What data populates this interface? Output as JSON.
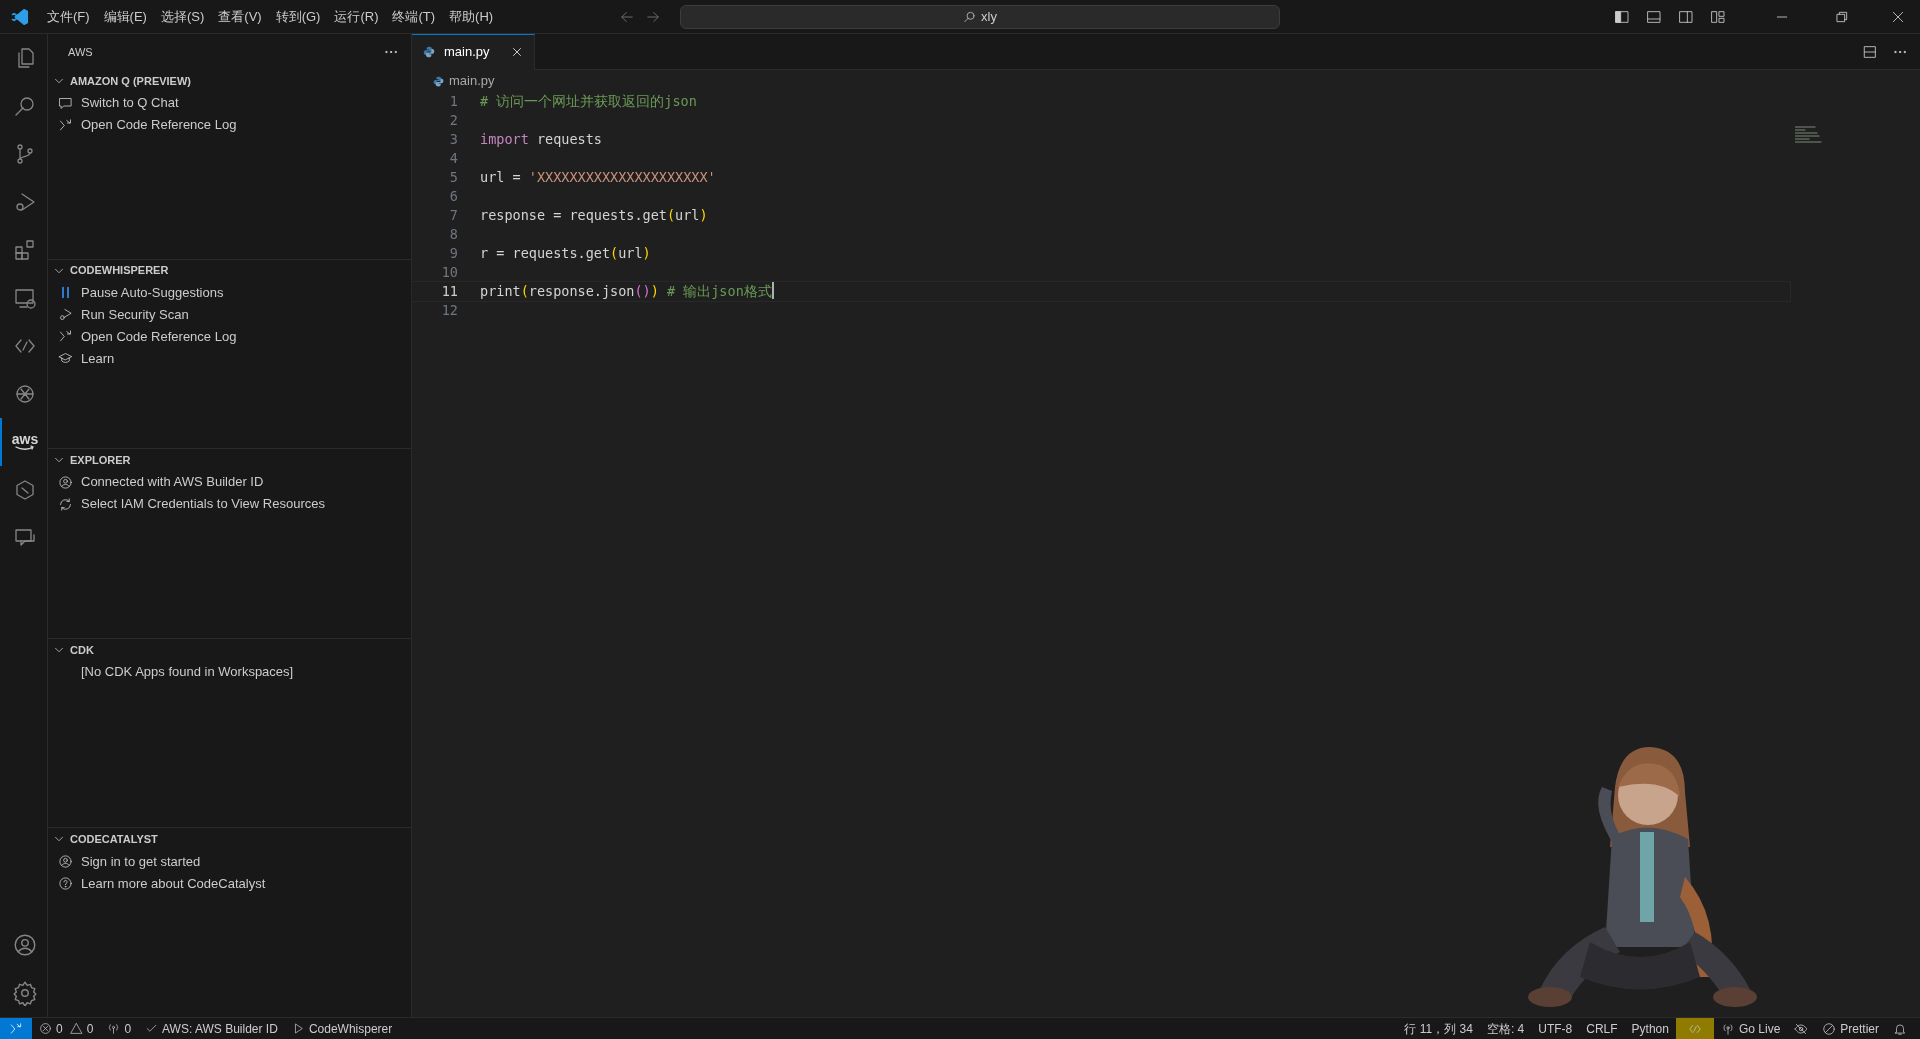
{
  "title_bar": {
    "menus": [
      "文件(F)",
      "编辑(E)",
      "选择(S)",
      "查看(V)",
      "转到(G)",
      "运行(R)",
      "终端(T)",
      "帮助(H)"
    ],
    "search": {
      "value": "xly"
    }
  },
  "activity_bar": [
    {
      "selected": false
    },
    {
      "selected": false
    },
    {
      "selected": false
    },
    {
      "selected": false
    },
    {
      "selected": false
    },
    {
      "selected": false
    },
    {
      "selected": false
    },
    {
      "selected": false
    },
    {
      "selected": true,
      "label": "aws"
    },
    {
      "selected": false
    },
    {
      "selected": false
    }
  ],
  "sidebar": {
    "title": "AWS",
    "sections": [
      {
        "title": "AMAZON Q (PREVIEW)",
        "expanded": true,
        "items": [
          "Switch to Q Chat",
          "Open Code Reference Log"
        ]
      },
      {
        "title": "CODEWHISPERER",
        "expanded": true,
        "items": [
          "Pause Auto-Suggestions",
          "Run Security Scan",
          "Open Code Reference Log",
          "Learn"
        ]
      },
      {
        "title": "EXPLORER",
        "expanded": true,
        "items": [
          "Connected with AWS Builder ID",
          "Select IAM Credentials to View Resources"
        ]
      },
      {
        "title": "CDK",
        "expanded": true,
        "items": [
          "[No CDK Apps found in Workspaces]"
        ]
      },
      {
        "title": "CODECATALYST",
        "expanded": true,
        "items": [
          "Sign in to get started",
          "Learn more about CodeCatalyst"
        ]
      }
    ]
  },
  "editor": {
    "tabs": [
      {
        "label": "main.py",
        "selected": true
      }
    ],
    "breadcrumb": "main.py",
    "lines": [
      {
        "number": "1",
        "current": false,
        "tokens": [
          {
            "kind": "comment",
            "text": "# 访问一个网址并获取返回的json"
          }
        ]
      },
      {
        "number": "2",
        "current": false
      },
      {
        "number": "3",
        "current": false,
        "tokens": [
          {
            "kind": "keyword",
            "text": "import"
          },
          {
            "kind": "plain",
            "text": " requests"
          }
        ]
      },
      {
        "number": "4",
        "current": false
      },
      {
        "number": "5",
        "current": false,
        "tokens": [
          {
            "kind": "plain",
            "text": "url = "
          },
          {
            "kind": "string",
            "text": "'XXXXXXXXXXXXXXXXXXXXX'"
          }
        ]
      },
      {
        "number": "6",
        "current": false
      },
      {
        "number": "7",
        "current": false,
        "tokens": [
          {
            "kind": "plain",
            "text": "response = requests.get"
          },
          {
            "kind": "bracket",
            "text": "("
          },
          {
            "kind": "plain",
            "text": "url"
          },
          {
            "kind": "bracket",
            "text": ")"
          }
        ]
      },
      {
        "number": "8",
        "current": false
      },
      {
        "number": "9",
        "current": false,
        "tokens": [
          {
            "kind": "plain",
            "text": "r = requests.get"
          },
          {
            "kind": "bracket",
            "text": "("
          },
          {
            "kind": "plain",
            "text": "url"
          },
          {
            "kind": "bracket",
            "text": ")"
          }
        ]
      },
      {
        "number": "10",
        "current": false
      },
      {
        "number": "11",
        "current": true,
        "tokens": [
          {
            "kind": "plain",
            "text": "print"
          },
          {
            "kind": "bracket",
            "text": "("
          },
          {
            "kind": "plain",
            "text": "response.json"
          },
          {
            "kind": "bracket2",
            "text": "()"
          },
          {
            "kind": "bracket",
            "text": ")"
          },
          {
            "kind": "comment",
            "text": " # 输出json格式"
          }
        ]
      },
      {
        "number": "12",
        "current": false
      }
    ]
  },
  "status_bar": {
    "left": [
      {
        "kind": "text",
        "text": "0"
      },
      {
        "kind": "text",
        "text": "0"
      },
      {
        "kind": "text",
        "text": "0"
      },
      {
        "kind": "text",
        "text": "AWS: AWS Builder ID"
      },
      {
        "kind": "text",
        "text": "CodeWhisperer"
      }
    ],
    "right": [
      {
        "kind": "text",
        "text": "行 11，列 34"
      },
      {
        "kind": "text",
        "text": "空格: 4"
      },
      {
        "kind": "text",
        "text": "UTF-8"
      },
      {
        "kind": "text",
        "text": "CRLF"
      },
      {
        "kind": "text",
        "text": "Python"
      },
      {
        "kind": "icon",
        "highlighted": true
      },
      {
        "kind": "text",
        "text": "Go Live"
      },
      {
        "kind": "icon",
        "highlighted": false
      },
      {
        "kind": "text",
        "text": "Prettier"
      },
      {
        "kind": "icon",
        "highlighted": false
      }
    ]
  }
}
